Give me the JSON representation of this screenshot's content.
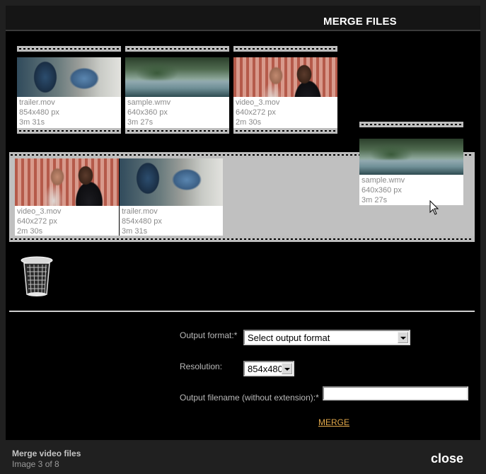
{
  "header": {
    "title": "MERGE FILES"
  },
  "library": [
    {
      "name": "trailer.mov",
      "resolution": "854x480 px",
      "duration": "3m 31s",
      "thumb": "trailer"
    },
    {
      "name": "sample.wmv",
      "resolution": "640x360 px",
      "duration": "3m 27s",
      "thumb": "sample"
    },
    {
      "name": "video_3.mov",
      "resolution": "640x272 px",
      "duration": "2m 30s",
      "thumb": "video3"
    }
  ],
  "timeline": [
    {
      "name": "video_3.mov",
      "resolution": "640x272 px",
      "duration": "2m 30s",
      "thumb": "video3"
    },
    {
      "name": "trailer.mov",
      "resolution": "854x480 px",
      "duration": "3m 31s",
      "thumb": "trailer"
    }
  ],
  "dragging": {
    "name": "sample.wmv",
    "resolution": "640x360 px",
    "duration": "3m 27s",
    "thumb": "sample"
  },
  "form": {
    "output_format_label": "Output format:*",
    "output_format_value": "Select output format",
    "resolution_label": "Resolution:",
    "resolution_value": "854x480",
    "filename_label": "Output filename (without extension):*",
    "filename_value": "",
    "merge_label": "MERGE"
  },
  "footer": {
    "title": "Merge video files",
    "counter": "Image 3 of 8",
    "close_label": "close"
  },
  "icons": {
    "trash": "trash-can-icon",
    "cursor": "mouse-pointer-icon"
  },
  "colors": {
    "link": "#e2a84a",
    "background": "#000000",
    "strip": "#c0c0c0"
  }
}
